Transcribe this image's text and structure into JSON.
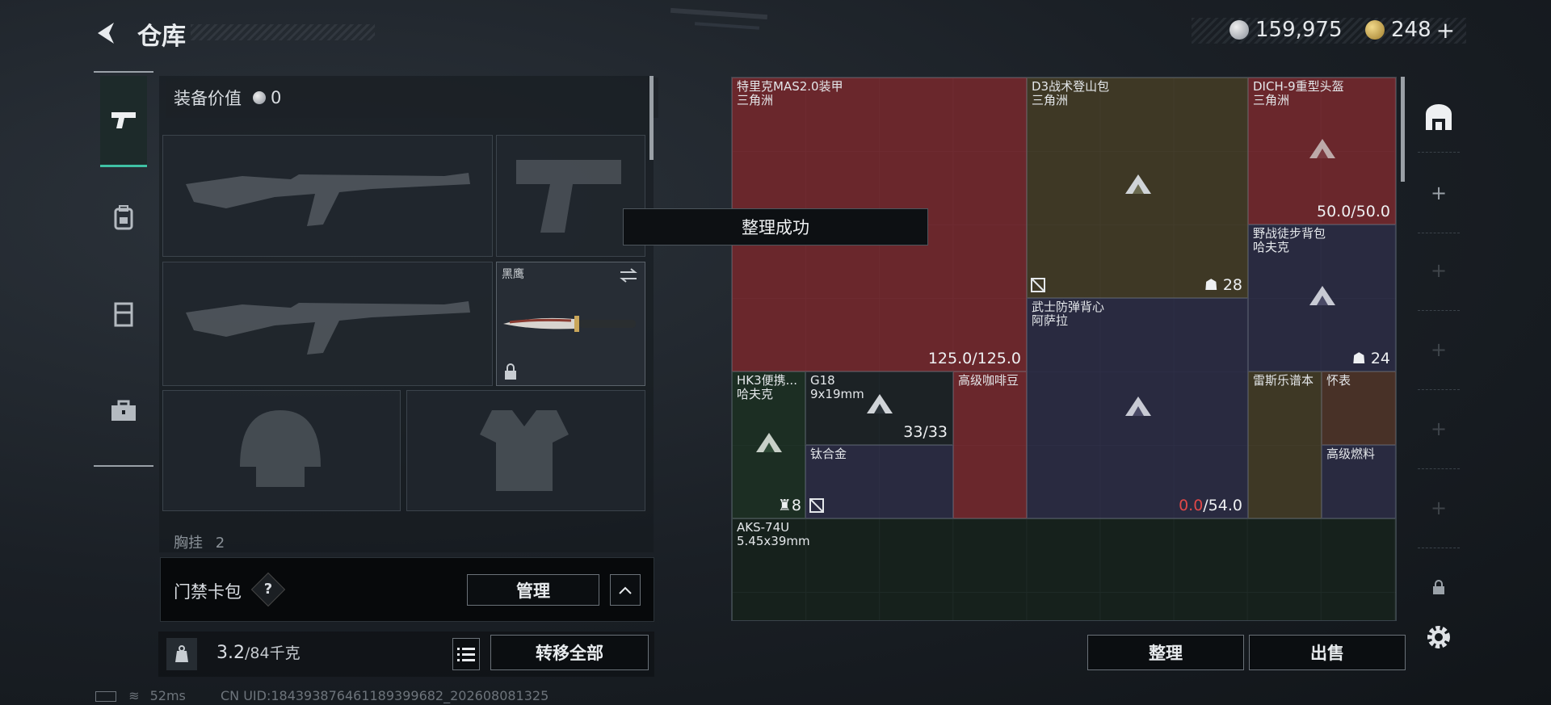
{
  "header": {
    "title": "仓库",
    "silver_amount": "159,975",
    "gold_amount": "248",
    "gold_plus": "+"
  },
  "left_panel": {
    "equip_value_label": "装备价值",
    "equip_value": "0",
    "knife_slot_name": "黑鹰",
    "chest_rig_label": "胸挂",
    "chest_rig_count": "2",
    "card_pack_label": "门禁卡包",
    "help_glyph": "?",
    "manage_button": "管理",
    "weight_current": "3.2",
    "weight_max": "/84千克",
    "transfer_all_button": "转移全部"
  },
  "status_bar": {
    "ping": "52ms",
    "uid": "CN UID:1843938764611893996​82_202608081325"
  },
  "toast": "整理成功",
  "grid": {
    "items": [
      {
        "id": "armor",
        "name": "特里克MAS2.0装甲\n三角洲",
        "value": "125.0/125.0"
      },
      {
        "id": "backpack-d3",
        "name": "D3战术登山包\n三角洲",
        "badge": "28"
      },
      {
        "id": "helmet",
        "name": "DICH-9重型头盔\n三角洲",
        "value": "50.0/50.0"
      },
      {
        "id": "backpack-field",
        "name": "野战徒步背包\n哈夫克",
        "badge": "24"
      },
      {
        "id": "vest",
        "name": "武士防弹背心\n阿萨拉",
        "value_red": "0.0",
        "value_rest": "/54.0"
      },
      {
        "id": "hk3",
        "name": "HK3便携...\n哈夫克",
        "badge": "8"
      },
      {
        "id": "g18",
        "name": "G18\n9x19mm",
        "value": "33/33"
      },
      {
        "id": "coffee",
        "name": "高级咖啡豆"
      },
      {
        "id": "titanium",
        "name": "钛合金"
      },
      {
        "id": "notebook",
        "name": "雷斯乐谱本"
      },
      {
        "id": "watch",
        "name": "怀表"
      },
      {
        "id": "fuel",
        "name": "高级燃料"
      },
      {
        "id": "aks",
        "name": "AKS-74U\n5.45x39mm"
      }
    ]
  },
  "buttons": {
    "sort": "整理",
    "sell": "出售"
  },
  "rail": {
    "add": "+"
  }
}
